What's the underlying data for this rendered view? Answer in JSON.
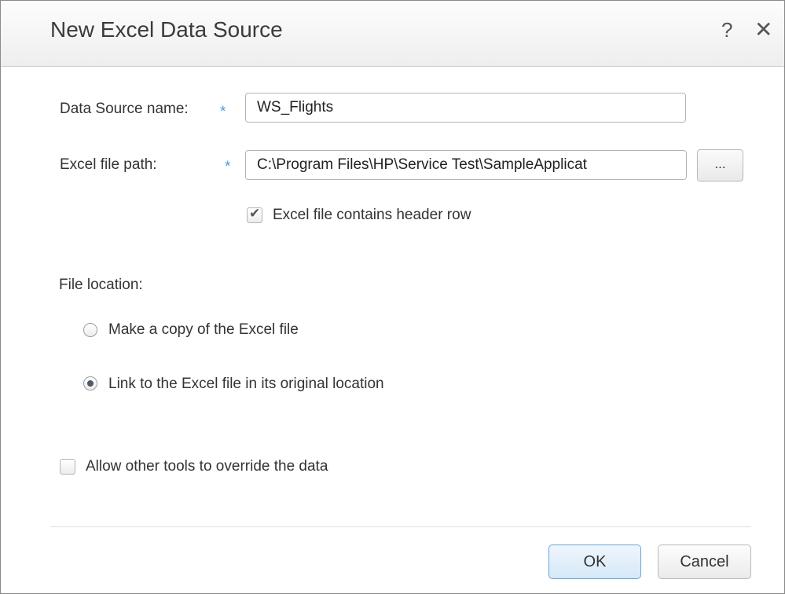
{
  "dialog": {
    "title": "New Excel Data Source",
    "help_label": "?",
    "close_label": "✕"
  },
  "form": {
    "name_label": "Data Source name:",
    "name_value": "WS_Flights",
    "path_label": "Excel file path:",
    "path_value": "C:\\Program Files\\HP\\Service Test\\SampleApplicat",
    "browse_label": "...",
    "required_marker": "*",
    "header_row_label": "Excel file contains header row",
    "header_row_checked": true,
    "file_location_label": "File location:",
    "location_options": [
      {
        "label": "Make a copy of the Excel file",
        "selected": false
      },
      {
        "label": "Link to the Excel file in its original location",
        "selected": true
      }
    ],
    "override_label": "Allow other tools to override the data",
    "override_checked": false
  },
  "buttons": {
    "ok": "OK",
    "cancel": "Cancel"
  },
  "colors": {
    "required_marker": "#4a9ae8",
    "ok_border": "#6aa6d8",
    "radio_dot": "#4d5a6b"
  }
}
